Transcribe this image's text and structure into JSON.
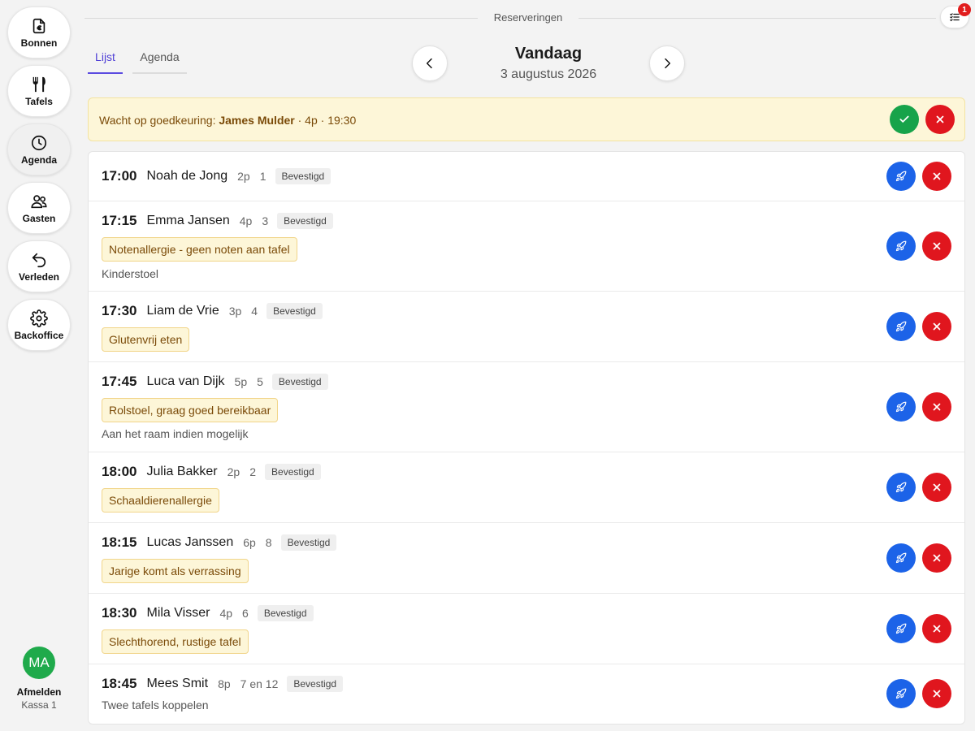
{
  "sidebar": {
    "items": [
      {
        "label": "Bonnen",
        "icon": "receipt-euro-icon"
      },
      {
        "label": "Tafels",
        "icon": "fork-knife-icon"
      },
      {
        "label": "Agenda",
        "icon": "clock-icon"
      },
      {
        "label": "Gasten",
        "icon": "users-icon"
      },
      {
        "label": "Verleden",
        "icon": "undo-arrow-icon"
      },
      {
        "label": "Backoffice",
        "icon": "gear-icon"
      }
    ],
    "avatar_initials": "MA",
    "logout_label": "Afmelden",
    "register_label": "Kassa 1"
  },
  "header": {
    "title": "Reserveringen",
    "notification_count": "1"
  },
  "tabs": [
    {
      "label": "Lijst",
      "active": true
    },
    {
      "label": "Agenda",
      "active": false
    }
  ],
  "date_nav": {
    "title": "Vandaag",
    "date": "3 augustus 2026"
  },
  "pending": {
    "prefix": "Wacht op goedkeuring:",
    "name": "James Mulder",
    "details": "· 4p · 19:30"
  },
  "reservations": [
    {
      "time": "17:00",
      "name": "Noah de Jong",
      "people": "2p",
      "table": "1",
      "status": "Bevestigd",
      "note": "",
      "extra": ""
    },
    {
      "time": "17:15",
      "name": "Emma Jansen",
      "people": "4p",
      "table": "3",
      "status": "Bevestigd",
      "note": "Notenallergie - geen noten aan tafel",
      "extra": "Kinderstoel"
    },
    {
      "time": "17:30",
      "name": "Liam de Vrie",
      "people": "3p",
      "table": "4",
      "status": "Bevestigd",
      "note": "Glutenvrij eten",
      "extra": ""
    },
    {
      "time": "17:45",
      "name": "Luca van Dijk",
      "people": "5p",
      "table": "5",
      "status": "Bevestigd",
      "note": "Rolstoel, graag goed bereikbaar",
      "extra": "Aan het raam indien mogelijk"
    },
    {
      "time": "18:00",
      "name": "Julia Bakker",
      "people": "2p",
      "table": "2",
      "status": "Bevestigd",
      "note": "Schaaldierenallergie",
      "extra": ""
    },
    {
      "time": "18:15",
      "name": "Lucas Janssen",
      "people": "6p",
      "table": "8",
      "status": "Bevestigd",
      "note": "Jarige komt als verrassing",
      "extra": ""
    },
    {
      "time": "18:30",
      "name": "Mila Visser",
      "people": "4p",
      "table": "6",
      "status": "Bevestigd",
      "note": "Slechthorend, rustige tafel",
      "extra": ""
    },
    {
      "time": "18:45",
      "name": "Mees Smit",
      "people": "8p",
      "table": "7 en 12",
      "status": "Bevestigd",
      "note": "",
      "extra": "Twee tafels koppelen"
    }
  ],
  "colors": {
    "accent": "#5b4be0",
    "approve": "#17a34a",
    "reject": "#e0161e",
    "seat": "#1c63e8",
    "note_bg": "#fdf6d8"
  }
}
